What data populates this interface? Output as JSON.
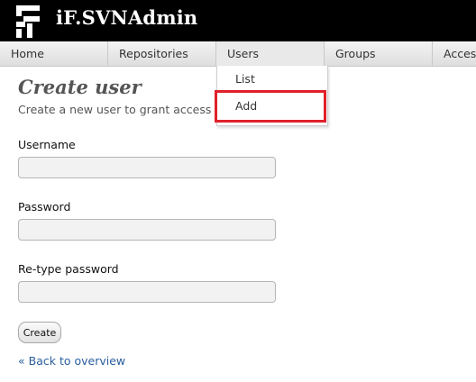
{
  "app": {
    "title": "iF.SVNAdmin"
  },
  "nav": {
    "items": [
      {
        "label": "Home"
      },
      {
        "label": "Repositories"
      },
      {
        "label": "Users"
      },
      {
        "label": "Groups"
      },
      {
        "label": "Access"
      }
    ]
  },
  "dropdown": {
    "items": [
      {
        "label": "List"
      },
      {
        "label": "Add"
      }
    ],
    "highlight_color": "#e0202a"
  },
  "page": {
    "title": "Create user",
    "subtitle": "Create a new user to grant access to"
  },
  "form": {
    "username_label": "Username",
    "username_value": "",
    "password_label": "Password",
    "password_value": "",
    "retype_label": "Re-type password",
    "retype_value": "",
    "submit_label": "Create"
  },
  "back_link": "« Back to overview",
  "colors": {
    "header": "#000000",
    "link": "#2a5d9f",
    "title": "#555555"
  }
}
